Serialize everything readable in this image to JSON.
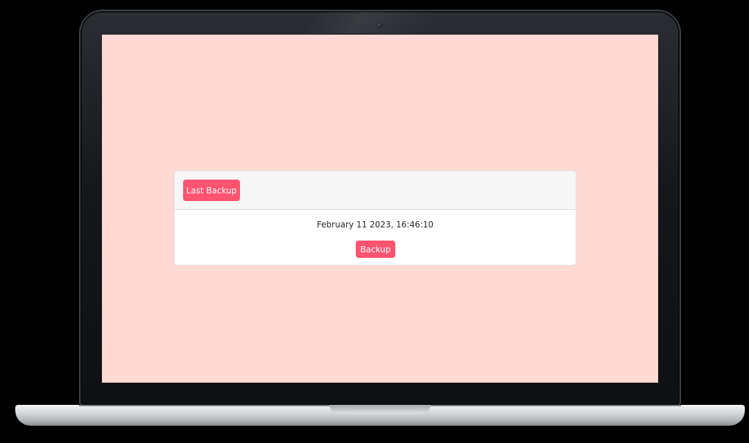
{
  "card": {
    "header_button_label": "Last Backup",
    "last_backup_time": "February 11 2023, 16:46:10",
    "backup_button_label": "Backup"
  },
  "colors": {
    "page_background": "#ffd9d3",
    "accent": "#ff5470",
    "card_header_background": "#f7f7f7",
    "card_background": "#ffffff"
  }
}
